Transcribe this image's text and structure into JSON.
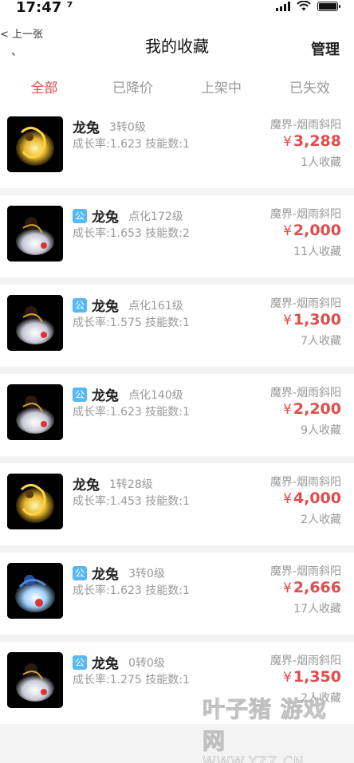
{
  "status_bar": {
    "time": "17:47 ⁷"
  },
  "nav": {
    "back_label": "< 上一张",
    "back_tick": "、",
    "title": "我的收藏",
    "manage_label": "管理"
  },
  "tabs": [
    {
      "label": "全部",
      "active": true
    },
    {
      "label": "已降价",
      "active": false
    },
    {
      "label": "上架中",
      "active": false
    },
    {
      "label": "已失效",
      "active": false
    }
  ],
  "currency_symbol": "¥",
  "public_tag": "公",
  "items": [
    {
      "name": "龙兔",
      "public": false,
      "level": "3转0级",
      "stats": "成长率:1.623 技能数:1",
      "server": "魔界-烟雨斜阳",
      "price": "3,288",
      "favorites": "1人收藏",
      "variant": "gold"
    },
    {
      "name": "龙兔",
      "public": true,
      "level": "点化172级",
      "stats": "成长率:1.653 技能数:2",
      "server": "魔界-烟雨斜阳",
      "price": "2,000",
      "favorites": "11人收藏",
      "variant": "white"
    },
    {
      "name": "龙兔",
      "public": true,
      "level": "点化161级",
      "stats": "成长率:1.575 技能数:1",
      "server": "魔界-烟雨斜阳",
      "price": "1,300",
      "favorites": "7人收藏",
      "variant": "white"
    },
    {
      "name": "龙兔",
      "public": true,
      "level": "点化140级",
      "stats": "成长率:1.623 技能数:1",
      "server": "魔界-烟雨斜阳",
      "price": "2,200",
      "favorites": "9人收藏",
      "variant": "white"
    },
    {
      "name": "龙兔",
      "public": false,
      "level": "1转28级",
      "stats": "成长率:1.453 技能数:1",
      "server": "魔界-烟雨斜阳",
      "price": "4,000",
      "favorites": "2人收藏",
      "variant": "gold"
    },
    {
      "name": "龙兔",
      "public": true,
      "level": "3转0级",
      "stats": "成长率:1.623 技能数:1",
      "server": "魔界-烟雨斜阳",
      "price": "2,666",
      "favorites": "17人收藏",
      "variant": "blue"
    },
    {
      "name": "龙兔",
      "public": true,
      "level": "0转0级",
      "stats": "成长率:1.275 技能数:1",
      "server": "魔界-烟雨斜阳",
      "price": "1,350",
      "favorites": "2人收藏",
      "variant": "white"
    }
  ],
  "watermark": {
    "main": "叶子猪 游戏网",
    "sub": "WWW.YZZ.CN"
  },
  "colors": {
    "accent": "#e24b4b",
    "tag_blue": "#55b9f3",
    "muted": "#999999",
    "background": "#f3f3f3"
  }
}
